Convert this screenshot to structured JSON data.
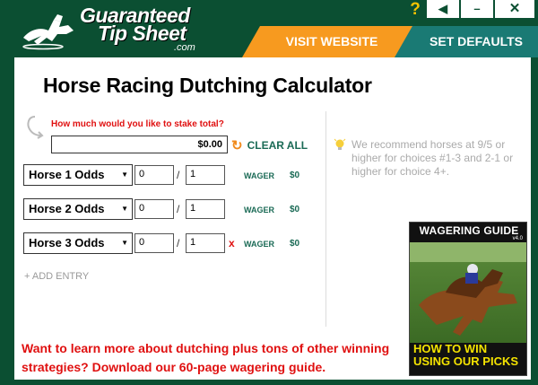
{
  "header": {
    "logo": {
      "line1": "Guaranteed",
      "line2": "Tip Sheet",
      "line3": ".com"
    },
    "help_glyph": "?",
    "window_buttons": {
      "back": "◀",
      "minimize": "–",
      "close": "✕"
    },
    "tabs": {
      "visit_website": "VISIT WEBSITE",
      "set_defaults": "SET DEFAULTS"
    },
    "colors": {
      "background": "#0b4f32",
      "orange_tab": "#f79a1f",
      "teal_tab": "#1a7a74"
    }
  },
  "main": {
    "title": "Horse Racing Dutching Calculator",
    "stake": {
      "question": "How much would you like to stake total?",
      "value": "$0.00",
      "clear_all": "CLEAR ALL"
    },
    "horses": [
      {
        "label": "Horse 1 Odds",
        "num": "0",
        "den": "1",
        "has_remove": false,
        "wager_label": "WAGER",
        "wager_value": "$0"
      },
      {
        "label": "Horse 2 Odds",
        "num": "0",
        "den": "1",
        "has_remove": false,
        "wager_label": "WAGER",
        "wager_value": "$0"
      },
      {
        "label": "Horse 3 Odds",
        "num": "0",
        "den": "1",
        "has_remove": true,
        "wager_label": "WAGER",
        "wager_value": "$0"
      }
    ],
    "slash": "/",
    "remove_glyph": "x",
    "add_entry": "+ ADD ENTRY",
    "tip": "We recommend horses at 9/5 or higher for choices #1-3 and 2-1 or higher for choice 4+.",
    "promo": "Want to learn more about dutching plus tons of other winning strategies? Download our 60-page wagering guide.",
    "guide": {
      "title": "WAGERING GUIDE",
      "version": "v4.0",
      "bottom_line1": "HOW TO WIN",
      "bottom_line2": "USING OUR PICKS"
    },
    "colors": {
      "accent_red": "#e01010",
      "accent_green": "#1a6a55",
      "accent_orange": "#f08a1c"
    }
  }
}
